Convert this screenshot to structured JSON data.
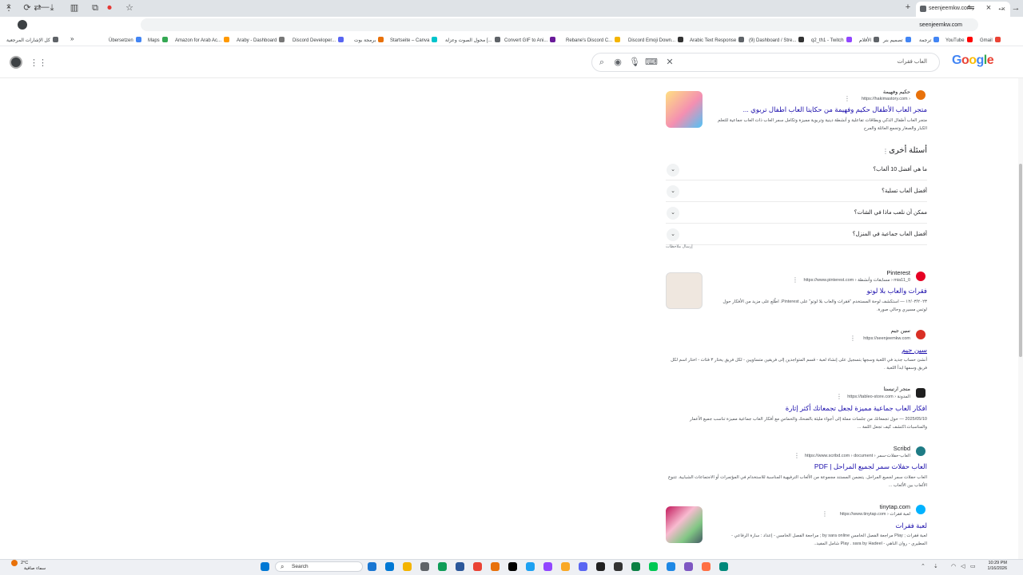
{
  "browser": {
    "tab_title": "seenjeemkw.com",
    "url": "seenjeemkw.com",
    "window_controls": [
      "×",
      "⟳",
      "—"
    ],
    "bookmarks": [
      {
        "label": "كل الإشارات المرجعية",
        "color": "#5f6368"
      },
      {
        "label": "Übersetzen",
        "color": "#4285f4"
      },
      {
        "label": "Maps",
        "color": "#34a853"
      },
      {
        "label": "Amazon for Arab Ac...",
        "color": "#ff9900"
      },
      {
        "label": "Araby - Dashboard",
        "color": "#777777"
      },
      {
        "label": "Discord Developer...",
        "color": "#5865f2"
      },
      {
        "label": "برمجة بوت",
        "color": "#e8710a"
      },
      {
        "label": "Startseite – Canva",
        "color": "#00c4cc"
      },
      {
        "label": "محول الصوت وعزلة [...",
        "color": "#5f6368"
      },
      {
        "label": "Convert GIF to Ani...",
        "color": "#6a1b9a"
      },
      {
        "label": "Rebane's Discord C...",
        "color": "#f4b400"
      },
      {
        "label": "Discord Emoji Down...",
        "color": "#333333"
      },
      {
        "label": "Arabic Text Response",
        "color": "#5f6368"
      },
      {
        "label": "(9) Dashboard / Stre...",
        "color": "#333333"
      },
      {
        "label": "q2_th1 - Twitch",
        "color": "#9146ff"
      },
      {
        "label": "الأقلام",
        "color": "#5f6368"
      },
      {
        "label": "تصميم بنر",
        "color": "#4285f4"
      },
      {
        "label": "ترجمة",
        "color": "#4285f4"
      },
      {
        "label": "YouTube",
        "color": "#ff0000"
      },
      {
        "label": "Gmail",
        "color": "#ea4335"
      }
    ]
  },
  "google": {
    "logo": [
      "G",
      "o",
      "o",
      "g",
      "l",
      "e"
    ],
    "query": "العاب فقرات",
    "icons": {
      "search": "search-icon",
      "lens": "lens-icon",
      "mic": "mic-icon",
      "keyboard": "keyboard-icon",
      "clear": "clear-icon"
    }
  },
  "results": [
    {
      "site": "حكيم وفهيمة",
      "url": "https://hakimastory.com ›",
      "title": "متجر العاب الأطفال حكيم وفهيمة من حكايتا العاب اطفال تربوي ...",
      "snippet": "متجر العاب أطفال الذكي وبطاقات تفاعلية و أنشطة دينية وتربوية مميزة وتكامل سمر العاب ذات العاب جماعية للتعلم الكبار والصغار وتجمع العائلة والمرح",
      "fav_color": "#e8710a",
      "thumb": true
    },
    {
      "site": "Pinterest",
      "url": "https://www.pinterest.com › مسابقات وأنشطة › mia11_0",
      "title": "فقرات والعاب بلا لوتو",
      "snippet": "١٢/٠٣/٢٠٢٣ — استكشف لوحة المستخدم \"فقرات والعاب بلا لوتو\" على Pinterest. اطّلع على مزيد من الأفكار حول لوتس مسيري وحالي صورة.",
      "fav_color": "#e60023",
      "thumb": true
    },
    {
      "site": "سين جيم",
      "url": "https://seenjeemkw.com",
      "title": "سين جيم",
      "snippet": "أنشئ حساب جديد في اللعبة وسجها بتسجيل على إنشاء لعبة - قسم المتواجدين إلى فريقين متساويين - لكل فريق يختار ٣ فئات - اختار اسم لكل فريق وسمها ابدأ اللعبة .",
      "fav_color": "#d93025",
      "thumb": false
    },
    {
      "site": "متجر ارتيستا",
      "url": "https://tableo-store.com › المدونة",
      "title": "افكار العاب جماعية مميزة لجعل تجمعاتك أكثر إثارة",
      "snippet": "2025/05/10 — حول تجمعاتك من جلسات مملة إلى أجواء مليئة بالضحك والحماس مع أفكار العاب جماعية مميزة تناسب جميع الأعمار والمناسبات.اكتشف كيف تجعل اللمة ...",
      "fav_color": "#1f1f1f",
      "thumb": false
    },
    {
      "site": "Scribd",
      "url": "https://www.scribd.com › document › العاب-حفلات-سمر",
      "title": "العاب حفلات سمر لجميع المراحل | PDF",
      "snippet": "العاب حفلات سمر لجميع المراحل. يتضمن المستند مجموعة من الألعاب الترفيهية المناسبة للاستخدام في المؤتمرات أو الاجتماعات الشبابية. تتنوع الألعاب بين الألعاب ...",
      "fav_color": "#1e7b85",
      "thumb": false
    },
    {
      "site": "tinytap.com",
      "url": "https://www.tinytap.com › لعبة فقرات",
      "title": "لعبة فقرات",
      "snippet": "لعبة فقرات ; Play مراجعة الفصل الخامس by sara online ; مراجعة الفصل الخامس - إعداد : سارة الرفاعي - المطيري - روان الناهي - Play . sara by Hadeel شامل المفيد..",
      "fav_color": "#00b2ff",
      "thumb": true
    }
  ],
  "paa": {
    "title": "أسئلة أخرى",
    "questions": [
      "ما هي أفضل 10 ألعاب؟",
      "أفضل ألعاب تسلية؟",
      "ممكن أن نلعب ماذا في الشات؟",
      "أفضل العاب جماعية في المنزل؟"
    ],
    "feedback": "إرسال ملاحظات"
  },
  "taskbar": {
    "weather_temp": "2°C",
    "weather_desc": "سماء صافية",
    "search_label": "Search",
    "time": "10:29 PM",
    "date": "1/16/2026",
    "apps": [
      "#1976d2",
      "#0078d4",
      "#f4b400",
      "#5f6368",
      "#0f9d58",
      "#2b579a",
      "#ea4335",
      "#e8710a",
      "#000000",
      "#1da1f2",
      "#9146ff",
      "#f9a825",
      "#5865f2",
      "#212121",
      "#333333",
      "#0b8043",
      "#00c853",
      "#1e88e5",
      "#7e57c2",
      "#ff7043",
      "#00897b"
    ]
  }
}
